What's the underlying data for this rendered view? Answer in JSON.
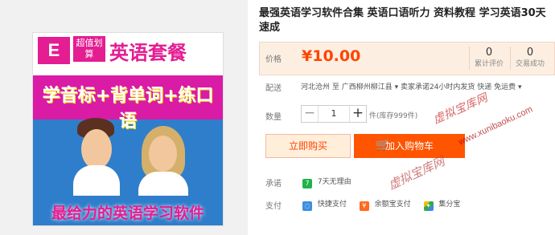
{
  "product": {
    "title": "最强英语学习软件合集 英语口语听力 资料教程 学习英语30天速成",
    "image": {
      "badge": "E",
      "badge_text": "超值划算",
      "headline": "英语套餐",
      "subheadline": "学音标+背单词+练口语",
      "bottom_text": "最给力的英语学习软件"
    }
  },
  "price": {
    "label": "价格",
    "value": "¥10.00",
    "reviews_count": "0",
    "reviews_label": "累计评价",
    "transactions_count": "0",
    "transactions_label": "交易成功"
  },
  "delivery": {
    "label": "配送",
    "text": "河北沧州 至  广西柳州柳江县 ▾   卖家承诺24小时内发货   快递 免运费 ▾"
  },
  "quantity": {
    "label": "数量",
    "minus": "−",
    "value": "1",
    "plus": "+",
    "stock": "件(库存999件)"
  },
  "actions": {
    "buy_now": "立即购买",
    "add_to_cart": "加入购物车",
    "cart_icon": "cart-icon"
  },
  "services": {
    "promise_label": "承诺",
    "promise_icon": "7",
    "promise_text": "7天无理由",
    "payment_label": "支付",
    "payment_items": [
      "快捷支付",
      "余额宝支付",
      "集分宝"
    ]
  },
  "watermark": {
    "main": "虚拟宝库网",
    "url": "www.xunibaoku.com",
    "cn": "虚拟宝库网"
  },
  "colors": {
    "accent": "#ff5400",
    "price": "#ff4400"
  }
}
